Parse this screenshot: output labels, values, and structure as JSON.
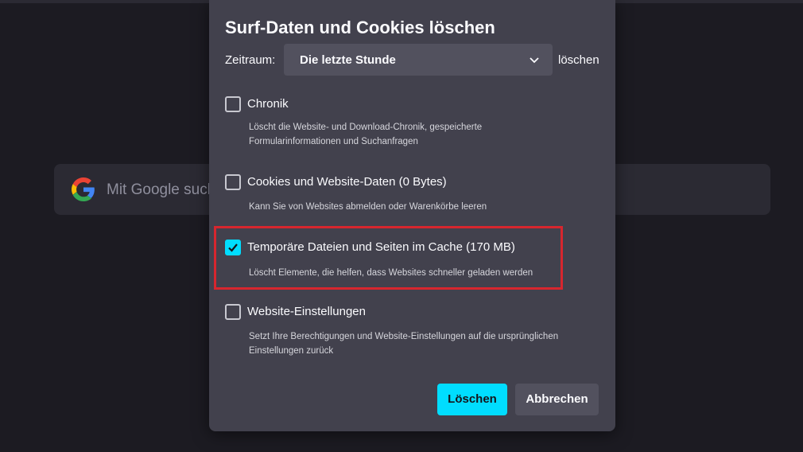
{
  "background": {
    "search_placeholder": "Mit Google such",
    "search_icon": "google-g-icon"
  },
  "dialog": {
    "title": "Surf-Daten und Cookies löschen",
    "time_label": "Zeitraum:",
    "time_value": "Die letzte Stunde",
    "time_suffix": "löschen",
    "options": [
      {
        "label": "Chronik",
        "description": "Löscht die Website- und Download-Chronik, gespeicherte Formularinformationen und Suchanfragen",
        "checked": false
      },
      {
        "label": "Cookies und Website-Daten (0 Bytes)",
        "description": "Kann Sie von Websites abmelden oder Warenkörbe leeren",
        "checked": false
      },
      {
        "label": "Temporäre Dateien und Seiten im Cache (170 MB)",
        "description": "Löscht Elemente, die helfen, dass Websites schneller geladen werden",
        "checked": true
      },
      {
        "label": "Website-Einstellungen",
        "description": "Setzt Ihre Berechtigungen und Website-Einstellungen auf die ursprünglichen Einstellungen zurück",
        "checked": false
      }
    ],
    "primary_button": "Löschen",
    "secondary_button": "Abbrechen"
  },
  "colors": {
    "accent": "#00ddff",
    "highlight_border": "#d7262e",
    "dialog_bg": "#42414d"
  }
}
